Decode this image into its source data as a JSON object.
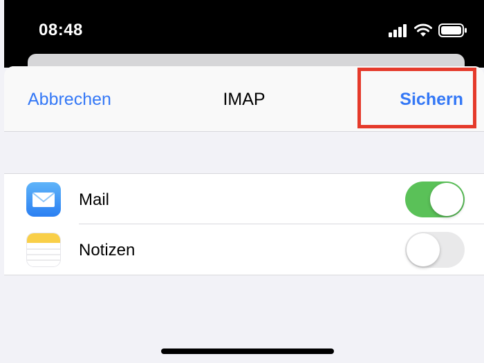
{
  "status_bar": {
    "time": "08:48",
    "icons": [
      "cellular-signal-icon",
      "wifi-icon",
      "battery-icon"
    ]
  },
  "nav": {
    "cancel_label": "Abbrechen",
    "title": "IMAP",
    "save_label": "Sichern"
  },
  "items": [
    {
      "label": "Mail",
      "icon": "mail-app-icon",
      "enabled": true
    },
    {
      "label": "Notizen",
      "icon": "notes-app-icon",
      "enabled": false
    }
  ],
  "colors": {
    "accent": "#3478f6",
    "toggle_on": "#5ac158",
    "toggle_off": "#e9e9ea",
    "highlight": "#e53a2b"
  }
}
